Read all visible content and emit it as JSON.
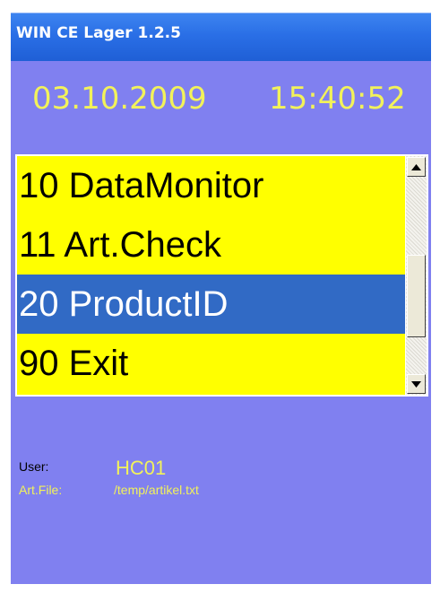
{
  "window": {
    "title": "WIN CE Lager 1.2.5"
  },
  "status": {
    "date": "03.10.2009",
    "time": "15:40:52"
  },
  "menu": {
    "items": [
      {
        "label": "10 DataMonitor",
        "selected": false
      },
      {
        "label": "11 Art.Check",
        "selected": false
      },
      {
        "label": "20 ProductID",
        "selected": true
      },
      {
        "label": "90 Exit",
        "selected": false
      }
    ]
  },
  "info": {
    "user_label": "User:",
    "user_value": "HC01",
    "artfile_label": "Art.File:",
    "artfile_value": "/temp/artikel.txt"
  },
  "colors": {
    "titlebar": "#2a6fe6",
    "client_bg": "#8080f0",
    "accent_yellow": "#f2f25a",
    "list_bg": "#ffff00",
    "selection": "#316ac5"
  },
  "icons": {
    "scroll_up": "scroll-up-arrow-icon",
    "scroll_down": "scroll-down-arrow-icon"
  }
}
